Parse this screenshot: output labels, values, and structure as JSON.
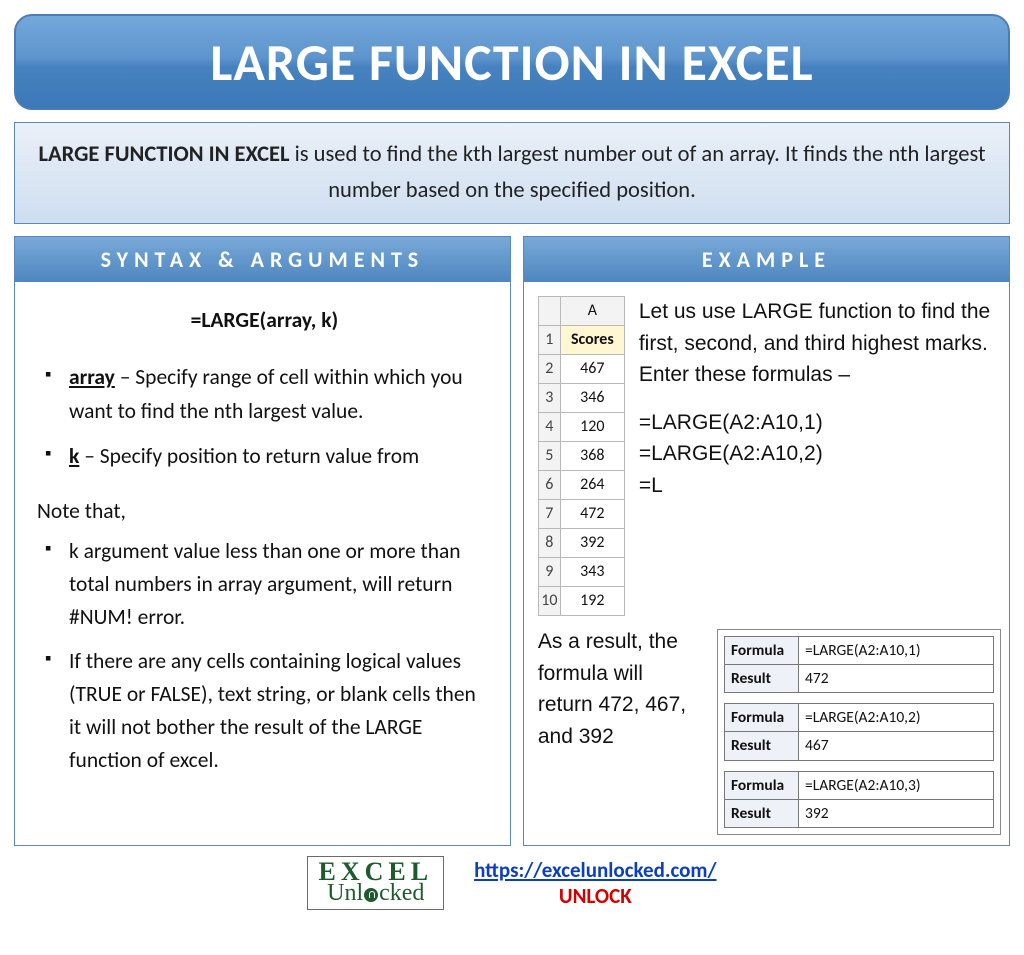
{
  "title": "LARGE FUNCTION IN EXCEL",
  "intro": {
    "lead": "LARGE FUNCTION IN EXCEL",
    "rest": " is used to find the kth largest number out of an array. It finds the nth largest number based on the specified position."
  },
  "syntax": {
    "header": "SYNTAX & ARGUMENTS",
    "formula": "=LARGE(array, k)",
    "args": [
      {
        "name": "array",
        "desc": " – Specify range of cell within which you want to find the nth largest value."
      },
      {
        "name": "k",
        "desc": " – Specify position to return value from"
      }
    ],
    "note_head": "Note that,",
    "notes": [
      "k argument value less than one or more than total numbers in array argument, will return #NUM! error.",
      "If there are any cells containing logical values (TRUE or FALSE), text string, or blank cells then it will not bother the result of the LARGE function of excel."
    ]
  },
  "example": {
    "header": "EXAMPLE",
    "scores_col": "A",
    "scores_header": "Scores",
    "scores": [
      "467",
      "346",
      "120",
      "368",
      "264",
      "472",
      "392",
      "343",
      "192"
    ],
    "row_labels": [
      "1",
      "2",
      "3",
      "4",
      "5",
      "6",
      "7",
      "8",
      "9",
      "10"
    ],
    "text1": "Let us use LARGE function to find the first, second, and third highest marks. Enter these formulas –",
    "formulas": [
      "=LARGE(A2:A10,1)",
      "=LARGE(A2:A10,2)",
      "=LARGE(A2:A10,3)"
    ],
    "partial_prefix": "=L",
    "result_text": "As a result, the formula will return 472, 467, and 392",
    "label_formula": "Formula",
    "label_result": "Result",
    "results": [
      {
        "formula": "=LARGE(A2:A10,1)",
        "result": "472"
      },
      {
        "formula": "=LARGE(A2:A10,2)",
        "result": "467"
      },
      {
        "formula": "=LARGE(A2:A10,3)",
        "result": "392"
      }
    ]
  },
  "footer": {
    "logo_top": "EXCEL",
    "logo_bottom": "Unlocked",
    "url": "https://excelunlocked.com/",
    "unlock": "UNLOCK"
  }
}
